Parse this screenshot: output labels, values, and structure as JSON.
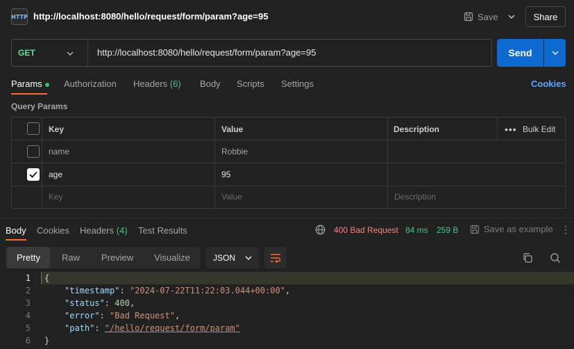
{
  "header": {
    "title": "http://localhost:8080/hello/request/form/param?age=95",
    "save_label": "Save",
    "share_label": "Share"
  },
  "request": {
    "method": "GET",
    "url": "http://localhost:8080/hello/request/form/param?age=95",
    "send_label": "Send"
  },
  "request_tabs": {
    "params": "Params",
    "authorization": "Authorization",
    "headers": "Headers",
    "headers_count": "(6)",
    "body": "Body",
    "scripts": "Scripts",
    "settings": "Settings",
    "cookies": "Cookies"
  },
  "query_params": {
    "label": "Query Params",
    "columns": {
      "key": "Key",
      "value": "Value",
      "description": "Description",
      "bulk_edit": "Bulk Edit"
    },
    "rows": [
      {
        "key": "name",
        "value": "Robbie",
        "checked": false
      },
      {
        "key": "age",
        "value": "95",
        "checked": true
      }
    ],
    "placeholder": {
      "key": "Key",
      "value": "Value",
      "description": "Description"
    }
  },
  "response_tabs": {
    "body": "Body",
    "cookies": "Cookies",
    "headers": "Headers",
    "headers_count": "(4)",
    "test_results": "Test Results"
  },
  "response_meta": {
    "status": "400 Bad Request",
    "time": "84 ms",
    "size": "259 B",
    "save_example": "Save as example"
  },
  "format": {
    "pretty": "Pretty",
    "raw": "Raw",
    "preview": "Preview",
    "visualize": "Visualize",
    "language": "JSON"
  },
  "code": {
    "line_numbers": [
      "1",
      "2",
      "3",
      "4",
      "5",
      "6"
    ],
    "open_brace": "{",
    "close_brace": "}",
    "timestamp_key": "\"timestamp\"",
    "timestamp_val": "\"2024-07-22T11:22:03.044+00:00\"",
    "status_key": "\"status\"",
    "status_val": "400",
    "error_key": "\"error\"",
    "error_val": "\"Bad Request\"",
    "path_key": "\"path\"",
    "path_val": "\"/hello/request/form/param\""
  },
  "colors": {
    "accent": "#ff6c37",
    "send": "#0d6ad0",
    "method": "#6bdd9a",
    "status_error": "#f0887d",
    "ok_green": "#4cc38a"
  }
}
